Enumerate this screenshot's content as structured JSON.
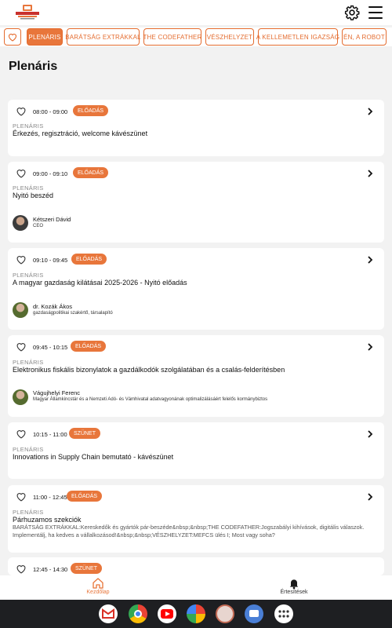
{
  "header": {
    "logo_icon": "conference-logo-icon",
    "settings_icon": "gear-icon",
    "menu_icon": "hamburger-menu-icon"
  },
  "tabs": {
    "favorites_icon": "heart-icon",
    "items": [
      {
        "label": "PLENÁRIS",
        "active": true
      },
      {
        "label": "BARÁTSÁG EXTRÁKKAL",
        "active": false
      },
      {
        "label": "THE CODEFATHER",
        "active": false
      },
      {
        "label": "VÉSZHELYZET",
        "active": false
      },
      {
        "label": "A KELLEMETLEN IGAZSÁG",
        "active": false
      },
      {
        "label": "ÉN, A ROBOT",
        "active": false
      }
    ]
  },
  "page_title": "Plenáris",
  "sessions": [
    {
      "time": "08:00 - 09:00",
      "badge": "ELŐADÁS",
      "category": "PLENÁRIS",
      "title": "Érkezés, regisztráció, welcome kávészünet"
    },
    {
      "time": "09:00 - 09:10",
      "badge": "ELŐADÁS",
      "category": "PLENÁRIS",
      "title": "Nyitó beszéd",
      "speaker": {
        "name": "Kétszeri Dávid",
        "role": "CEO"
      }
    },
    {
      "time": "09:10 - 09:45",
      "badge": "ELŐADÁS",
      "category": "PLENÁRIS",
      "title": "A magyar gazdaság kilátásai 2025-2026 - Nyitó előadás",
      "speaker": {
        "name": "dr. Kozák Ákos",
        "role": "gazdaságpolitikai szakértő, társalapító"
      }
    },
    {
      "time": "09:45 - 10:15",
      "badge": "ELŐADÁS",
      "category": "PLENÁRIS",
      "title": "Elektronikus fiskális bizonylatok a gazdálkodók szolgálatában és a csalás-felderítésben",
      "speaker": {
        "name": "Vágujhelyi Ferenc",
        "role": "Magyar Államkincstár és a Nemzeti Adó- és Vámhivatal adatvagyonának optimalizálásáért felelős kormánybiztos"
      }
    },
    {
      "time": "10:15 - 11:00",
      "badge": "SZÜNET",
      "category": "PLENÁRIS",
      "title": "Innovations in Supply Chain bemutató - kávészünet"
    },
    {
      "time": "11:00 - 12:45",
      "badge": "ELŐADÁS",
      "category": "PLENÁRIS",
      "title": "Párhuzamos szekciók",
      "description": "BARÁTSÁG EXTRÁKKAL:Kereskedők és gyártók pár-beszéde&nbsp;&nbsp;THE CODEFATHER:Jogszabályi kihívások, digitális válaszok. Implementálj, ha kedves a vállalkozásod!&nbsp;&nbsp;VÉSZHELYZET:MEFCS ülés I; Most vagy soha?"
    },
    {
      "time": "12:45 - 14:30",
      "badge": "SZÜNET"
    }
  ],
  "bottom_nav": [
    {
      "label": "Kezdőlap",
      "icon": "home-icon",
      "active": true
    },
    {
      "label": "Értesítések",
      "icon": "bell-icon",
      "active": false
    }
  ],
  "system_apps": [
    "gmail-icon",
    "chrome-icon",
    "youtube-icon",
    "photos-icon",
    "event-app-icon",
    "messages-icon",
    "app-drawer-icon"
  ],
  "colors": {
    "accent": "#e8763b",
    "background": "#f2f2f2"
  }
}
